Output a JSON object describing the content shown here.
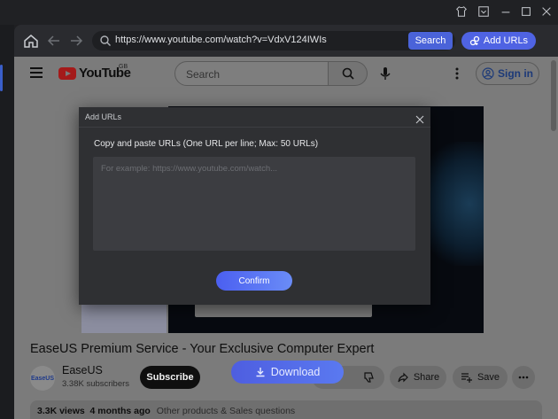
{
  "browser": {
    "url": "https://www.youtube.com/watch?v=VdxV124IWIs",
    "search_label": "Search",
    "add_urls_label": "Add URLs"
  },
  "youtube": {
    "logo_text": "YouTube",
    "country_code": "GB",
    "search_placeholder": "Search",
    "sign_in_label": "Sign in",
    "video_title": "EaseUS Premium Service - Your Exclusive Computer Expert",
    "channel_name": "EaseUS",
    "channel_avatar_text": "EaseUS",
    "subscribers": "3.38K subscribers",
    "subscribe_label": "Subscribe",
    "share_label": "Share",
    "save_label": "Save",
    "views": "3.3K views",
    "age": "4 months ago",
    "category": "Other products & Sales questions"
  },
  "download": {
    "label": "Download"
  },
  "dialog": {
    "title": "Add URLs",
    "instruction": "Copy and paste URLs (One URL per line; Max: 50 URLs)",
    "placeholder": "For example: https://www.youtube.com/watch...",
    "value": "",
    "confirm_label": "Confirm"
  },
  "colors": {
    "accent": "#4f63e3",
    "dialog_bg": "#2f3033",
    "overlay": "#7b7b7b"
  }
}
